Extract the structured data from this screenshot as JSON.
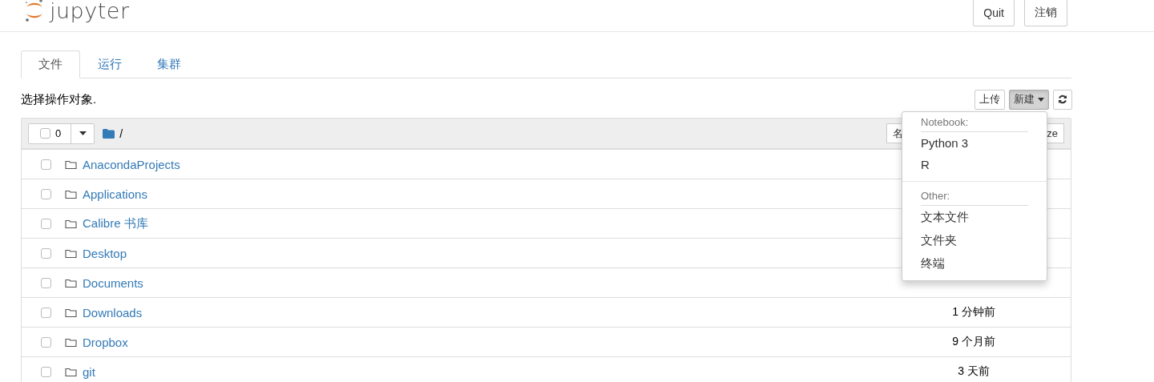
{
  "header": {
    "logo_text": "jupyter",
    "buttons": [
      "Quit",
      "注销"
    ]
  },
  "tabs": [
    {
      "label": "文件",
      "selected": true
    },
    {
      "label": "运行",
      "selected": false
    },
    {
      "label": "集群",
      "selected": false
    }
  ],
  "prompt": "选择操作对象.",
  "toolbar": {
    "upload": "上传",
    "new": "新建",
    "new_open": true
  },
  "list_header": {
    "select_count": "0",
    "select_all_checked": false,
    "path": "/",
    "sort_buttons": [
      "名",
      "ze"
    ]
  },
  "rows": [
    {
      "name": "AnacondaProjects",
      "checked": false
    },
    {
      "name": "Applications",
      "checked": false
    },
    {
      "name": "Calibre 书库",
      "checked": false
    },
    {
      "name": "Desktop",
      "checked": false
    },
    {
      "name": "Documents",
      "checked": false
    },
    {
      "name": "Downloads",
      "checked": false,
      "modified": "1 分钟前"
    },
    {
      "name": "Dropbox",
      "checked": false,
      "modified": "9 个月前"
    },
    {
      "name": "git",
      "checked": false,
      "modified": "3 天前"
    }
  ],
  "new_menu": {
    "sections": [
      {
        "heading": "Notebook:",
        "items": [
          "Python 3",
          "R"
        ]
      },
      {
        "heading": "Other:",
        "items": [
          "文本文件",
          "文件夹",
          "终端"
        ]
      }
    ]
  }
}
